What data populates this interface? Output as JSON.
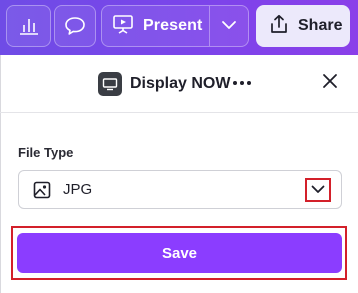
{
  "toolbar": {
    "insights_icon": "bar-chart-icon",
    "comment_icon": "comment-bubble-icon",
    "present_label": "Present",
    "present_icon": "presentation-screen-icon",
    "present_dropdown_icon": "chevron-down-icon",
    "share_label": "Share",
    "share_icon": "upload-share-icon"
  },
  "panel": {
    "title": "Display NOW",
    "app_icon": "display-app-icon",
    "more_icon": "ellipsis-icon",
    "close_icon": "close-icon"
  },
  "file_type": {
    "label": "File Type",
    "selected": "JPG",
    "option_icon": "image-icon",
    "dropdown_icon": "chevron-down-icon"
  },
  "save": {
    "label": "Save"
  },
  "colors": {
    "toolbar_gradient_start": "#6f4ce6",
    "toolbar_gradient_end": "#8a3fe9",
    "primary_button": "#8b3dff",
    "share_button_bg": "#ece9fb",
    "highlight_red": "#d3202a"
  }
}
